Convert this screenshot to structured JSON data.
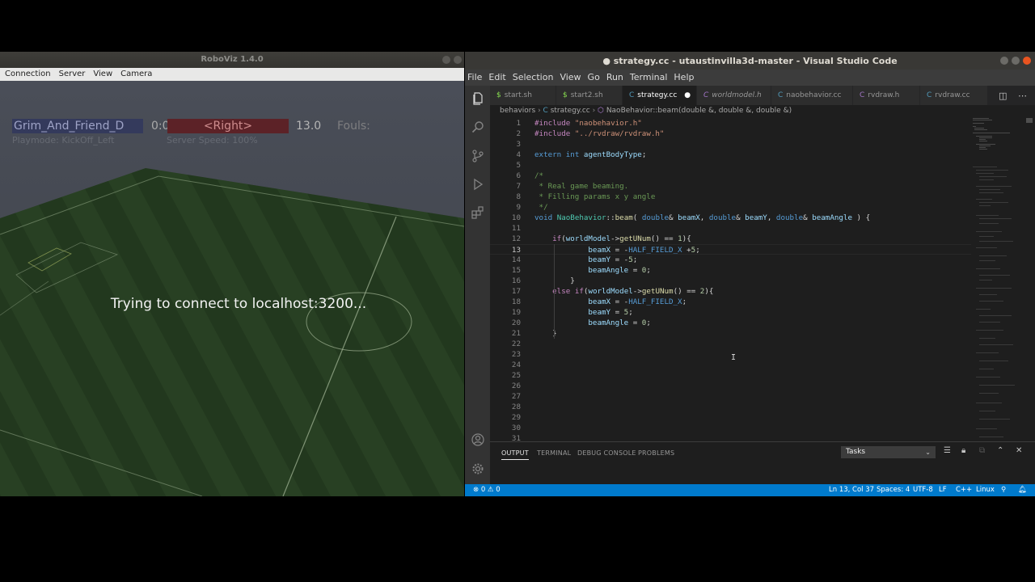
{
  "roboviz": {
    "title": "RoboViz 1.4.0",
    "menu": [
      "Connection",
      "Server",
      "View",
      "Camera"
    ],
    "team_left": "Grim_And_Friend_D",
    "score": "0:0",
    "team_right": "<Right>",
    "time": "13.0",
    "fouls": "Fouls:",
    "playmode": "Playmode: KickOff_Left",
    "server_speed": "Server Speed: 100%",
    "connect_message": "Trying to connect to localhost:3200..."
  },
  "vscode": {
    "title": "● strategy.cc - utaustinvilla3d-master - Visual Studio Code",
    "menu": [
      "File",
      "Edit",
      "Selection",
      "View",
      "Go",
      "Run",
      "Terminal",
      "Help"
    ],
    "tabs": [
      {
        "label": "start.sh",
        "icon": "shell-file-icon"
      },
      {
        "label": "start2.sh",
        "icon": "shell-file-icon"
      },
      {
        "label": "strategy.cc",
        "icon": "cpp-file-icon",
        "modified": "●"
      },
      {
        "label": "worldmodel.h",
        "icon": "cpp-header-icon"
      },
      {
        "label": "naobehavior.cc",
        "icon": "cpp-file-icon"
      },
      {
        "label": "rvdraw.h",
        "icon": "cpp-header-icon"
      },
      {
        "label": "rvdraw.cc",
        "icon": "cpp-file-icon"
      }
    ],
    "breadcrumb": [
      "behaviors",
      "strategy.cc",
      "NaoBehavior::beam(double &, double &, double &)"
    ],
    "code_lines": [
      {
        "n": "1",
        "text": "#include \"naobehavior.h\""
      },
      {
        "n": "2",
        "text": "#include \"../rvdraw/rvdraw.h\""
      },
      {
        "n": "3",
        "text": ""
      },
      {
        "n": "4",
        "text": "extern int agentBodyType;"
      },
      {
        "n": "5",
        "text": ""
      },
      {
        "n": "6",
        "text": "/*"
      },
      {
        "n": "7",
        "text": " * Real game beaming."
      },
      {
        "n": "8",
        "text": " * Filling params x y angle"
      },
      {
        "n": "9",
        "text": " */"
      },
      {
        "n": "10",
        "text": "void NaoBehavior::beam( double& beamX, double& beamY, double& beamAngle ) {"
      },
      {
        "n": "11",
        "text": ""
      },
      {
        "n": "12",
        "text": "    if(worldModel->getUNum() == 1){"
      },
      {
        "n": "13",
        "text": "            beamX = -HALF_FIELD_X +5;"
      },
      {
        "n": "14",
        "text": "            beamY = -5;"
      },
      {
        "n": "15",
        "text": "            beamAngle = 0;"
      },
      {
        "n": "16",
        "text": "        }"
      },
      {
        "n": "17",
        "text": "    else if(worldModel->getUNum() == 2){"
      },
      {
        "n": "18",
        "text": "            beamX = -HALF_FIELD_X;"
      },
      {
        "n": "19",
        "text": "            beamY = 5;"
      },
      {
        "n": "20",
        "text": "            beamAngle = 0;"
      },
      {
        "n": "21",
        "text": "    }"
      },
      {
        "n": "22",
        "text": ""
      },
      {
        "n": "23",
        "text": ""
      },
      {
        "n": "24",
        "text": ""
      },
      {
        "n": "25",
        "text": ""
      },
      {
        "n": "26",
        "text": ""
      },
      {
        "n": "27",
        "text": ""
      },
      {
        "n": "28",
        "text": ""
      },
      {
        "n": "29",
        "text": ""
      },
      {
        "n": "30",
        "text": ""
      },
      {
        "n": "31",
        "text": ""
      }
    ],
    "current_line": "13",
    "panel_tabs": [
      "OUTPUT",
      "TERMINAL",
      "DEBUG CONSOLE",
      "PROBLEMS"
    ],
    "panel_active": "OUTPUT",
    "tasks_select": "Tasks",
    "status_left": "⊗ 0 ⚠ 0",
    "status_right": [
      "Ln 13, Col 37",
      "Spaces: 4",
      "UTF-8",
      "LF",
      "C++",
      "Linux"
    ],
    "colors": {
      "status_bar": "#007acc",
      "editor_bg": "#1e1e1e",
      "keyword": "#569cd6",
      "comment": "#6a9955",
      "string": "#ce9178",
      "preprocessor": "#c586c0"
    }
  }
}
